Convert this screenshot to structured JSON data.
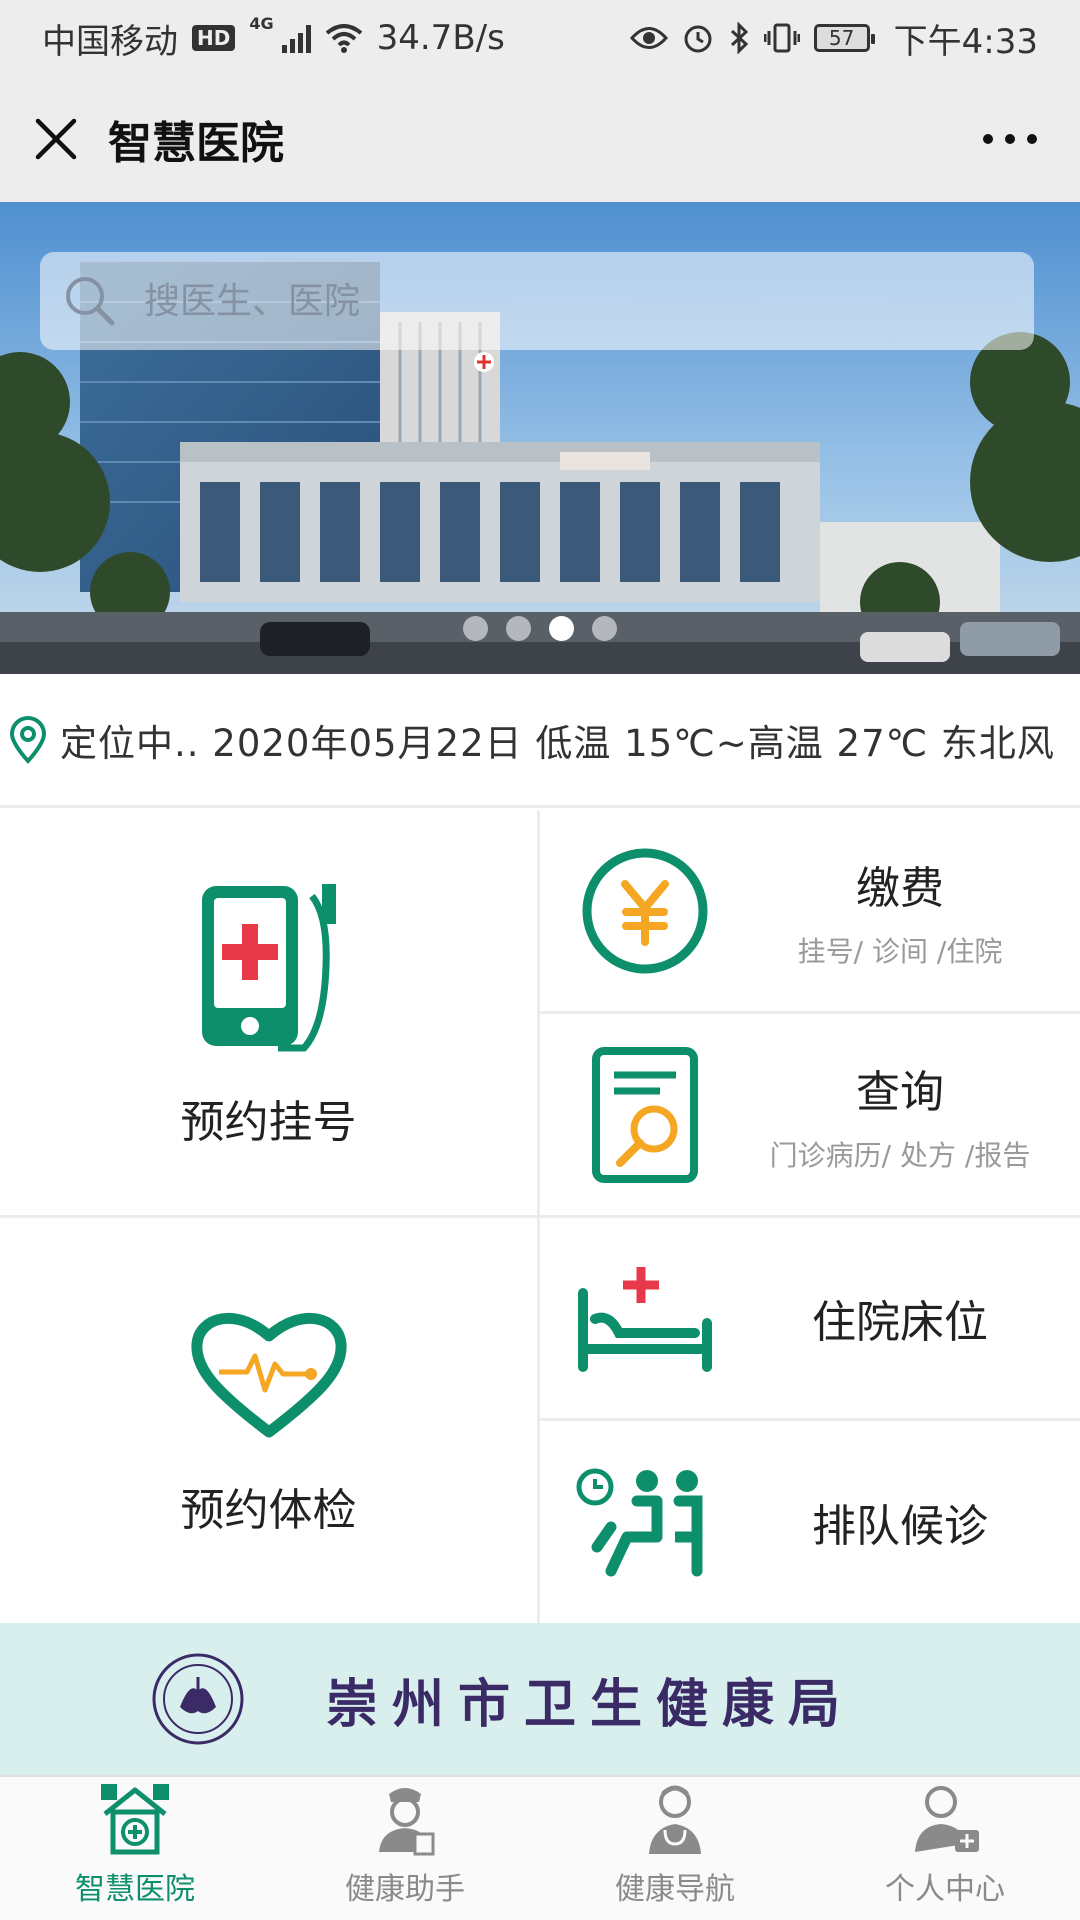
{
  "status_bar": {
    "carrier": "中国移动",
    "hd": "HD",
    "network": "4G",
    "speed": "34.7B/s",
    "battery": "57",
    "time": "下午4:33"
  },
  "title_bar": {
    "title": "智慧医院",
    "close_icon": "close-icon",
    "more_icon": "more-icon"
  },
  "banner": {
    "search_placeholder": "搜医生、医院",
    "slide_count": 4,
    "active_slide": 3
  },
  "info_bar": {
    "text": "定位中.. 2020年05月22日  低温 15℃~高温 27℃  东北风"
  },
  "services": {
    "appointment": {
      "label": "预约挂号",
      "icon": "phone-medical-icon"
    },
    "payment": {
      "title": "缴费",
      "subtitle": "挂号/ 诊间 /住院",
      "icon": "yuan-coin-icon"
    },
    "query": {
      "title": "查询",
      "subtitle": "门诊病历/ 处方 /报告",
      "icon": "document-search-icon"
    },
    "checkup": {
      "label": "预约体检",
      "icon": "heart-pulse-icon"
    },
    "bed": {
      "title": "住院床位",
      "icon": "hospital-bed-icon"
    },
    "queue": {
      "title": "排队候诊",
      "icon": "queue-waiting-icon"
    }
  },
  "footer_banner": {
    "name": "崇州市卫生健康局",
    "emblem": "health-bureau-emblem"
  },
  "tabs": [
    {
      "label": "智慧医院",
      "icon": "hospital-icon",
      "active": true
    },
    {
      "label": "健康助手",
      "icon": "nurse-icon",
      "active": false
    },
    {
      "label": "健康导航",
      "icon": "doctor-icon",
      "active": false
    },
    {
      "label": "个人中心",
      "icon": "user-medical-icon",
      "active": false
    }
  ],
  "colors": {
    "brand_green": "#0e8f6c",
    "accent_red": "#e8394a",
    "accent_orange": "#f5a623"
  }
}
